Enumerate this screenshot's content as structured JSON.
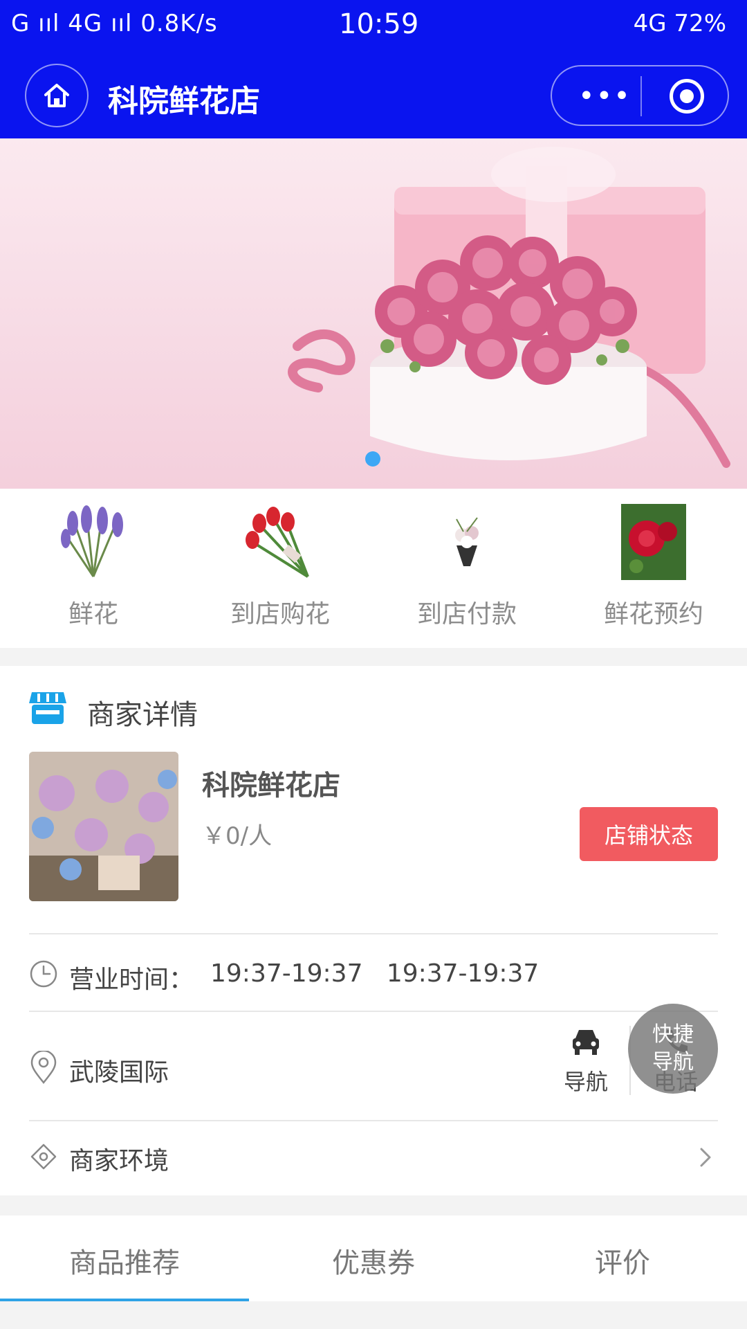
{
  "status_bar": {
    "left": "G ııl 4G ııl 0.8K/s",
    "time": "10:59",
    "right": "4G 72%"
  },
  "header": {
    "title": "科院鲜花店"
  },
  "categories": [
    {
      "label": "鲜花",
      "icon": "lavender-icon"
    },
    {
      "label": "到店购花",
      "icon": "tulip-bouquet-icon"
    },
    {
      "label": "到店付款",
      "icon": "small-bouquet-icon"
    },
    {
      "label": "鲜花预约",
      "icon": "rose-icon"
    }
  ],
  "merchant": {
    "section_title": "商家详情",
    "name": "科院鲜花店",
    "price": "￥0/人",
    "status_button": "店铺状态",
    "hours_label": "营业时间：",
    "hours_value": "19:37-19:37   19:37-19:37",
    "address": "武陵国际",
    "nav_label": "导航",
    "call_label": "电话",
    "environment_label": "商家环境"
  },
  "floating_button": {
    "line1": "快捷",
    "line2": "导航"
  },
  "tabs": [
    "商品推荐",
    "优惠券",
    "评价"
  ],
  "colors": {
    "header_bg": "#0a14ef",
    "accent": "#2fa3e6",
    "status_button": "#f15b60"
  }
}
